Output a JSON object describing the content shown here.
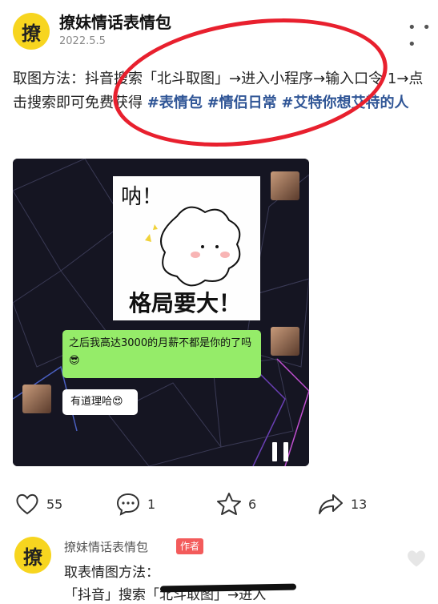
{
  "post": {
    "avatar_text": "撩",
    "author": "撩妹情话表情包",
    "date": "2022.5.5",
    "more_icon": "more-dots-icon",
    "caption_text": "取图方法：抖音搜索「北斗取图」→进入小程序→输入口令 1→点击搜索即可免费获得",
    "hashtags": [
      "#表情包",
      "#情侣日常",
      "#艾特你想艾特的人"
    ]
  },
  "video": {
    "sticker_top_text": "呐！",
    "sticker_bottom_text": "格局要大！",
    "bubble_green_text": "之后我高达3000的月薪不都是你的了吗😎",
    "bubble_white_text": "有道理哈😍",
    "pause_icon": "pause-icon"
  },
  "actions": {
    "likes": "55",
    "comments": "1",
    "favorites": "6",
    "shares": "13"
  },
  "comment": {
    "avatar_text": "撩",
    "author": "撩妹情话表情包",
    "badge": "作者",
    "line1": "取表情图方法：",
    "line2": "「抖音」搜索「北斗取图」→进入"
  },
  "colors": {
    "accent_yellow": "#f7d51f",
    "hashtag_blue": "#2f5596",
    "annotation_red": "#e8202e",
    "chat_green": "#95ec69",
    "badge_red": "#f35b5b"
  }
}
